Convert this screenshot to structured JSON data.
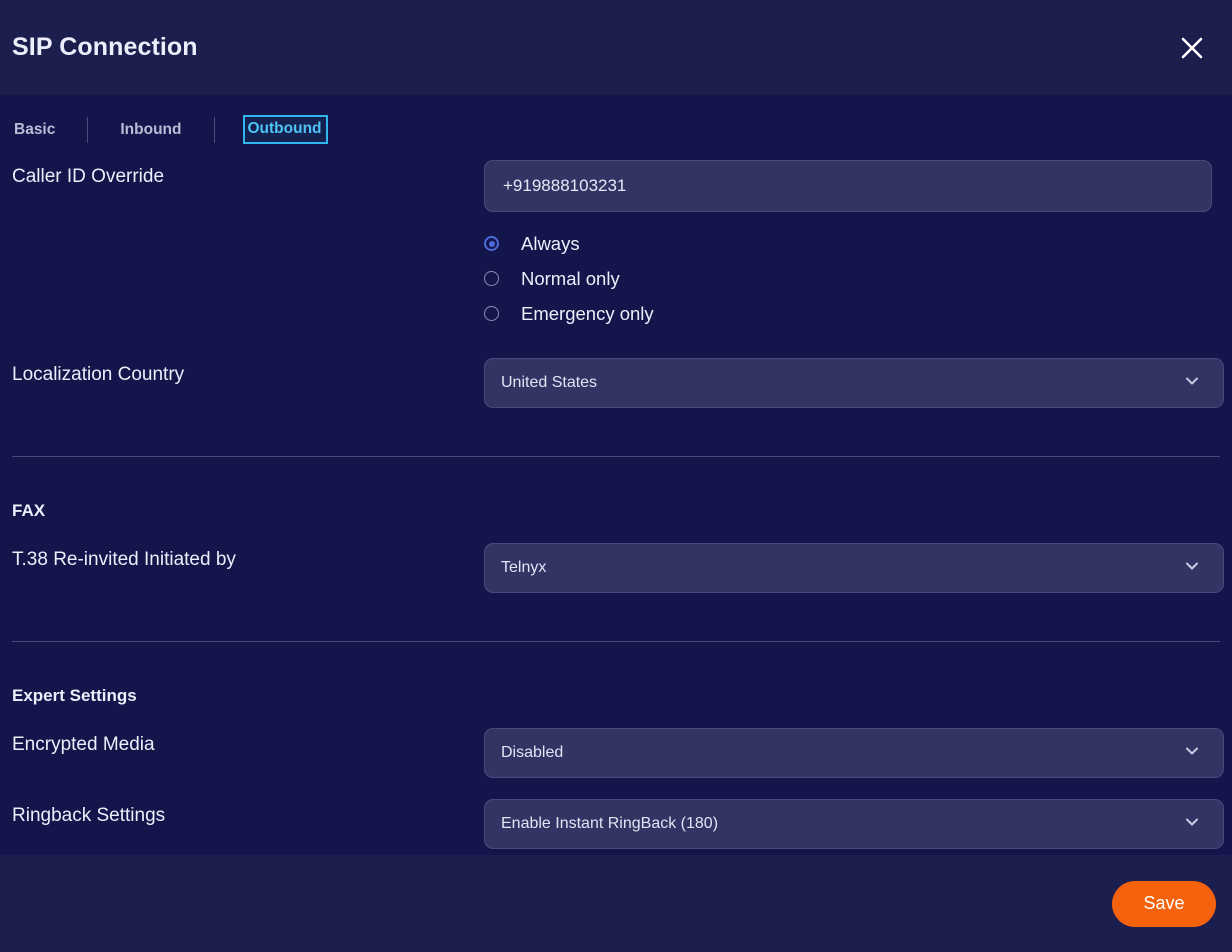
{
  "header": {
    "title": "SIP Connection",
    "close_icon": "close-icon"
  },
  "tabs": [
    {
      "label": "Basic",
      "active": false
    },
    {
      "label": "Inbound",
      "active": false
    },
    {
      "label": "Outbound",
      "active": true
    }
  ],
  "form": {
    "caller_id": {
      "label": "Caller ID Override",
      "value": "+919888103231",
      "placeholder": "",
      "options": [
        {
          "label": "Always",
          "checked": true
        },
        {
          "label": "Normal only",
          "checked": false
        },
        {
          "label": "Emergency only",
          "checked": false
        }
      ]
    },
    "localization_country": {
      "label": "Localization Country",
      "value": "United States"
    },
    "fax": {
      "section_title": "FAX",
      "t38": {
        "label": "T.38 Re-invited Initiated by",
        "value": "Telnyx"
      }
    },
    "expert": {
      "section_title": "Expert Settings",
      "encrypted_media": {
        "label": "Encrypted Media",
        "value": "Disabled"
      },
      "ringback": {
        "label": "Ringback Settings",
        "value": "Enable Instant RingBack (180)"
      }
    }
  },
  "footer": {
    "save_label": "Save"
  },
  "colors": {
    "background": "#14154a",
    "panel": "#1c1e4e",
    "field": "#323464",
    "accent_tab": "#31b6f0",
    "accent_radio": "#4d6ad8",
    "save_button": "#f4630c",
    "divider": "#4a4c78"
  }
}
